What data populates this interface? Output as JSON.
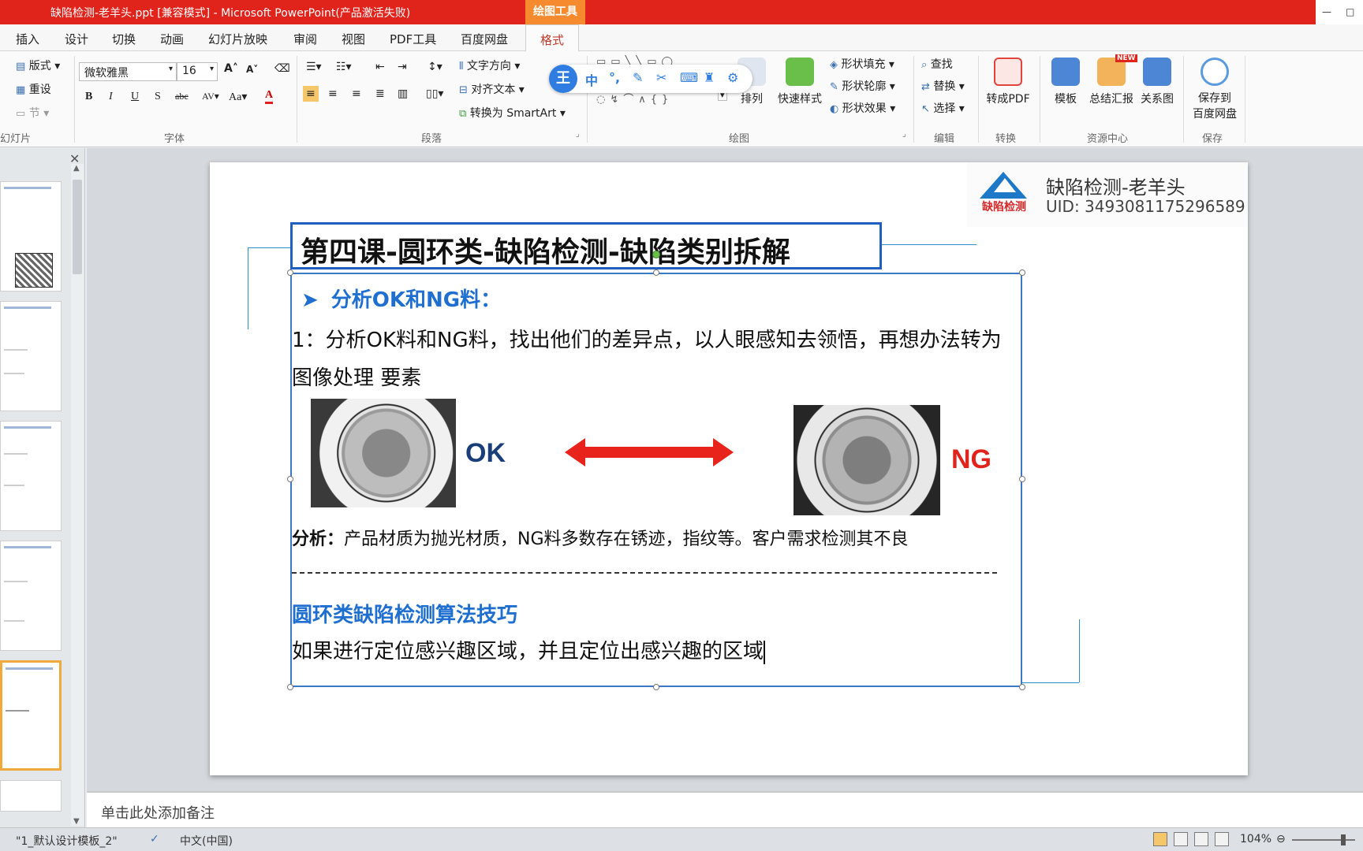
{
  "window": {
    "title": "缺陷检测-老羊头.ppt [兼容模式] - Microsoft PowerPoint(产品激活失败)",
    "context_tab": "绘图工具"
  },
  "tabs": [
    "插入",
    "设计",
    "切换",
    "动画",
    "幻灯片放映",
    "审阅",
    "视图",
    "PDF工具",
    "百度网盘",
    "格式"
  ],
  "active_tab": "格式",
  "ribbon": {
    "slides": {
      "layout": "版式",
      "reset": "重设",
      "section": "节",
      "label": "幻灯片"
    },
    "font": {
      "name": "微软雅黑",
      "size": "16",
      "label": "字体"
    },
    "paragraph": {
      "text_direction": "文字方向",
      "align_text": "对齐文本",
      "smartart": "转换为 SmartArt",
      "label": "段落"
    },
    "drawing": {
      "arrange": "排列",
      "quick_styles": "快速样式",
      "shape_fill": "形状填充",
      "shape_outline": "形状轮廓",
      "shape_effects": "形状效果",
      "label": "绘图"
    },
    "editing": {
      "find": "查找",
      "replace": "替换",
      "select": "选择",
      "label": "编辑"
    },
    "convert": {
      "to_pdf": "转成PDF",
      "label": "转换"
    },
    "resources": {
      "template": "模板",
      "summary": "总结汇报",
      "relation": "关系图",
      "new_badge": "NEW",
      "label": "资源中心"
    },
    "save": {
      "baidu": "保存到\n百度网盘",
      "label": "保存"
    }
  },
  "ime_bar": {
    "logo": "王",
    "mode": "中"
  },
  "slide": {
    "brand_name": "缺陷检测-老羊头",
    "brand_uid": "UID: 3493081175296589",
    "logo_text": "缺陷检测",
    "title": "第四课-圆环类-缺陷检测-缺陷类别拆解",
    "subhead": "分析OK和NG料：",
    "para1": "1：分析OK料和NG料，找出他们的差异点，以人眼感知去领悟，再想办法转为 图像处理 要素",
    "ok_label": "OK",
    "ng_label": "NG",
    "analysis_prefix": "分析：",
    "analysis_text": "产品材质为抛光材质，NG料多数存在锈迹，指纹等。客户需求检测其不良",
    "subhead2": "圆环类缺陷检测算法技巧",
    "para2": "如果进行定位感兴趣区域，并且定位出感兴趣的区域"
  },
  "notes_placeholder": "单击此处添加备注",
  "status": {
    "theme": "\"1_默认设计模板_2\"",
    "language": "中文(中国)",
    "zoom": "104%"
  },
  "colors": {
    "title_bar": "#e0231b",
    "accent_blue": "#1f6fd1",
    "ng_red": "#e0231b",
    "ok_navy": "#1a3e7a"
  }
}
